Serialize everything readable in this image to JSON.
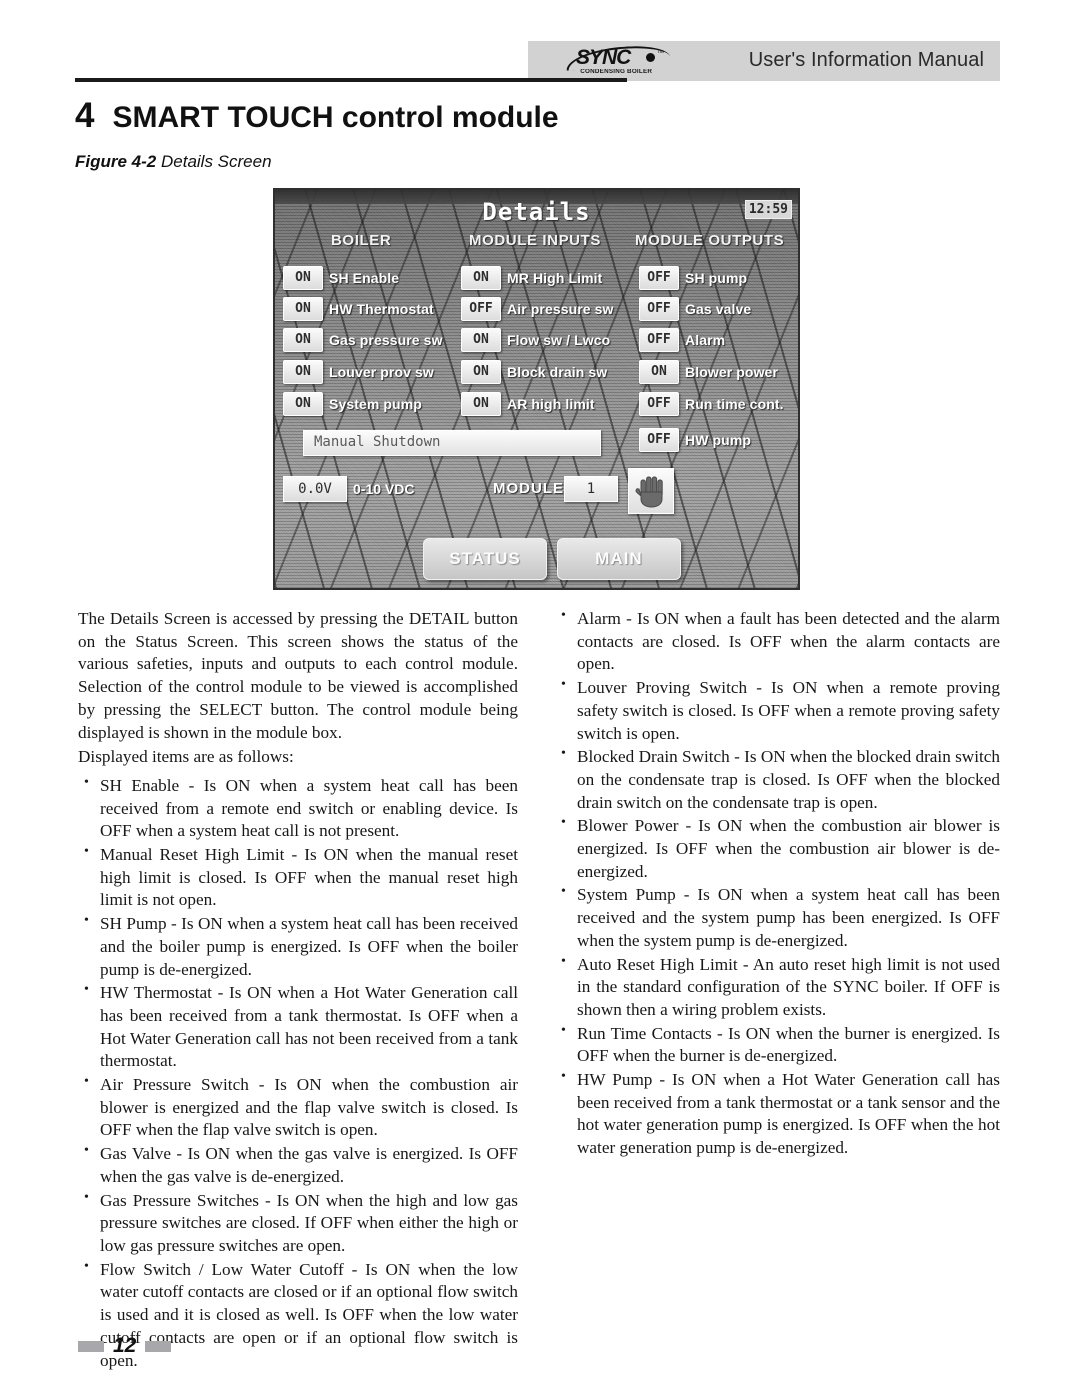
{
  "header": {
    "manual_title": "User's Information Manual",
    "logo_word": "SYNC",
    "logo_sub": "CONDENSING BOILER",
    "logo_tm": "™"
  },
  "chapter": {
    "number": "4",
    "title": "SMART TOUCH control module"
  },
  "figure": {
    "label": "Figure 4-2",
    "caption": "Details Screen"
  },
  "lcd": {
    "title": "Details",
    "clock": "12:59",
    "column_headers": [
      "BOILER",
      "MODULE INPUTS",
      "MODULE OUTPUTS"
    ],
    "boiler": [
      {
        "state": "ON",
        "label": "SH Enable"
      },
      {
        "state": "ON",
        "label": "HW Thermostat"
      },
      {
        "state": "ON",
        "label": "Gas pressure sw"
      },
      {
        "state": "ON",
        "label": "Louver prov sw"
      },
      {
        "state": "ON",
        "label": "System pump"
      }
    ],
    "module_inputs": [
      {
        "state": "ON",
        "label": "MR High Limit"
      },
      {
        "state": "OFF",
        "label": "Air pressure sw"
      },
      {
        "state": "ON",
        "label": "Flow sw / Lwco"
      },
      {
        "state": "ON",
        "label": "Block drain sw"
      },
      {
        "state": "ON",
        "label": "AR high limit"
      }
    ],
    "module_outputs": [
      {
        "state": "OFF",
        "label": "SH pump"
      },
      {
        "state": "OFF",
        "label": "Gas valve"
      },
      {
        "state": "OFF",
        "label": "Alarm"
      },
      {
        "state": "ON",
        "label": "Blower power"
      },
      {
        "state": "OFF",
        "label": "Run time cont."
      },
      {
        "state": "OFF",
        "label": "HW pump"
      }
    ],
    "shutdown_text": "Manual  Shutdown",
    "voltage_value": "0.0V",
    "voltage_label": "0-10 VDC",
    "module_label": "MODULE",
    "module_number": "1",
    "hand_icon": "hand-icon",
    "buttons": [
      "STATUS",
      "MAIN"
    ]
  },
  "body": {
    "intro": "The Details Screen is accessed by pressing the DETAIL button on the Status Screen.  This screen shows the status of the various safeties, inputs and outputs to each control module.  Selection of the control module to be viewed is accomplished by pressing the SELECT button.  The control module being displayed is shown in the module box.",
    "lead_in": "Displayed items are as follows:",
    "left_bullets": [
      "SH Enable -  Is ON when a system heat call has been received from a remote end switch or enabling device.  Is OFF when a system heat call is not present.",
      "Manual Reset High Limit - Is ON when the manual reset high limit is closed.  Is OFF when the manual reset high limit is not open.",
      "SH Pump - Is ON when a system heat call has been received and the boiler pump is energized.  Is OFF when the boiler pump is de-energized.",
      "HW Thermostat - Is ON when a Hot Water Generation call has been received from a tank thermostat.  Is OFF when a Hot Water Generation call has not been received from a tank thermostat.",
      "Air Pressure Switch - Is ON when the combustion air blower is energized and the flap valve switch is closed.  Is OFF when the flap valve switch is open.",
      "Gas Valve - Is ON when the gas valve is energized.  Is OFF when the gas valve is de-energized.",
      "Gas Pressure Switches - Is ON when the high and low gas pressure switches are closed.  If OFF when either the high or low gas pressure switches are open.",
      "Flow Switch / Low Water Cutoff - Is ON when the low water cutoff contacts are closed or if an optional flow switch is used and it is closed as well.  Is OFF when the low water cutoff contacts are open or if an optional flow switch is open."
    ],
    "right_bullets": [
      "Alarm - Is ON when a fault has been detected and the alarm contacts are closed.  Is OFF when the alarm contacts are open.",
      "Louver Proving Switch - Is ON when a remote proving safety switch is closed.  Is OFF when a remote proving safety switch is open.",
      "Blocked Drain Switch - Is ON when the blocked drain switch on the condensate trap is closed.  Is OFF when the blocked drain switch on the condensate trap is open.",
      "Blower Power - Is ON when the combustion air blower is energized.  Is OFF when the combustion air blower is de-energized.",
      "System Pump - Is ON when a system heat call has been received and the system pump has been energized.  Is OFF when the system pump is de-energized.",
      "Auto Reset High Limit - An auto reset high limit is not used in the standard configuration of the SYNC boiler.  If OFF is shown then a wiring problem exists.",
      "Run Time Contacts - Is ON when the burner is energized.  Is OFF when the burner is de-energized.",
      "HW Pump - Is ON when a Hot Water Generation call has been received from a tank thermostat or a tank sensor and the hot water generation pump is energized.  Is OFF when the hot water generation pump is de-energized."
    ]
  },
  "footer": {
    "page_number": "12"
  },
  "colors": {
    "header_band": "#d2d2d2",
    "rule": "#1b1b1b",
    "footer_box": "#a7a7ac",
    "text": "#181818"
  }
}
